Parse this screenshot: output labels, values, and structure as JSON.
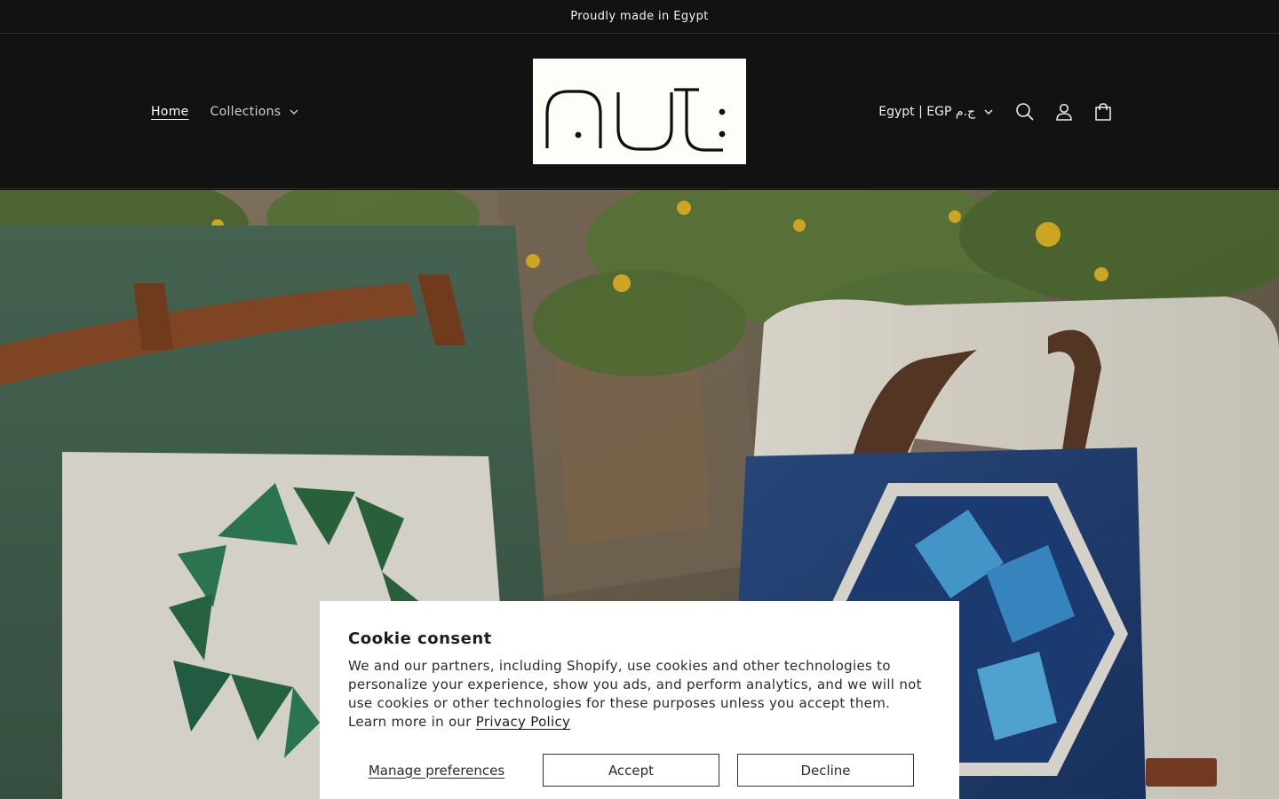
{
  "announcement": {
    "text": "Proudly made in Egypt"
  },
  "header": {
    "nav": [
      {
        "label": "Home",
        "active": true
      },
      {
        "label": "Collections",
        "has_dropdown": true
      }
    ],
    "logo_text": "nut",
    "country_selector": "Egypt | EGP ج.م",
    "icons": [
      "search-icon",
      "account-icon",
      "cart-icon"
    ]
  },
  "cookie_banner": {
    "title": "Cookie consent",
    "text": "We and our partners, including Shopify, use cookies and other technologies to personalize your experience, show you ads, and perform analytics, and we will not use cookies or other technologies for these purposes unless you accept them. Learn more in our",
    "privacy_link": "Privacy Policy",
    "manage_label": "Manage preferences",
    "accept_label": "Accept",
    "decline_label": "Decline"
  },
  "colors": {
    "header_bg": "#121212",
    "cookie_bg": "#ffffff",
    "text_light": "#ffffff",
    "text_dark": "#1d1d1d"
  }
}
